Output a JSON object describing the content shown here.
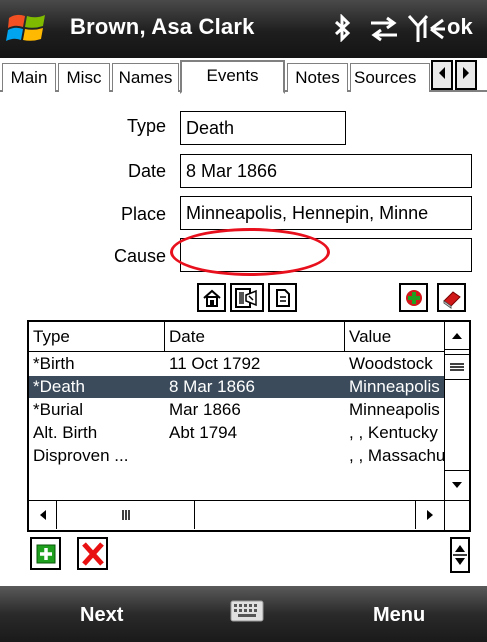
{
  "titlebar": {
    "title": "Brown, Asa Clark",
    "ok": "ok",
    "icons": [
      "windows-start-icon",
      "bluetooth-icon",
      "data-connection-icon",
      "signal-strength-icon",
      "volume-icon"
    ]
  },
  "tabs": [
    {
      "label": "Main",
      "active": false
    },
    {
      "label": "Misc",
      "active": false
    },
    {
      "label": "Names",
      "active": false
    },
    {
      "label": "Events",
      "active": true
    },
    {
      "label": "Notes",
      "active": false
    },
    {
      "label": "Sources",
      "active": false
    }
  ],
  "form": {
    "type_label": "Type",
    "type_value": "Death",
    "date_label": "Date",
    "date_value": "8 Mar 1866",
    "place_label": "Place",
    "place_value": "Minneapolis, Hennepin, Minne",
    "cause_label": "Cause",
    "cause_value": ""
  },
  "toolbar_icons": [
    "house-icon",
    "family-record-icon",
    "document-icon",
    "add-source-icon",
    "book-icon"
  ],
  "events_list": {
    "columns": [
      "Type",
      "Date",
      "Value"
    ],
    "rows": [
      {
        "type": "*Birth",
        "date": "11 Oct 1792",
        "value": "Woodstock",
        "selected": false
      },
      {
        "type": "*Death",
        "date": "8 Mar 1866",
        "value": "Minneapolis",
        "selected": true
      },
      {
        "type": "*Burial",
        "date": "Mar 1866",
        "value": "Minneapolis",
        "selected": false
      },
      {
        "type": "Alt. Birth",
        "date": "Abt 1794",
        "value": ", , Kentucky",
        "selected": false
      },
      {
        "type": "Disproven ...",
        "date": "",
        "value": ", , Massachusetts",
        "selected": false
      }
    ]
  },
  "softkeys": {
    "left": "Next",
    "right": "Menu"
  },
  "colors": {
    "selection": "#3b4b5b",
    "highlight_ellipse": "#e8101c",
    "add_green": "#1fa01f",
    "delete_red": "#e81010"
  }
}
